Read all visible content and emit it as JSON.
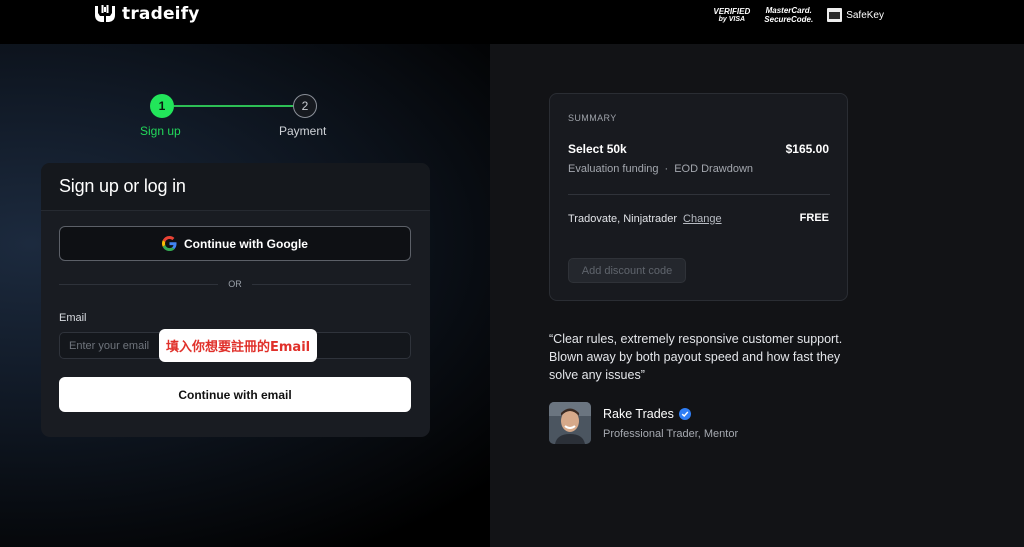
{
  "header": {
    "brand": "tradeify",
    "badges": {
      "visa_line1": "VERIFIED",
      "visa_line2": "by VISA",
      "mc_line1": "MasterCard.",
      "mc_line2": "SecureCode.",
      "safekey": "SafeKey"
    }
  },
  "steps": [
    {
      "number": "1",
      "label": "Sign up",
      "state": "active",
      "color": "#22e55a"
    },
    {
      "number": "2",
      "label": "Payment",
      "state": "pending"
    }
  ],
  "auth": {
    "title": "Sign up or log in",
    "google_button": "Continue with Google",
    "divider": "OR",
    "email_label": "Email",
    "email_placeholder": "Enter your email",
    "email_value": "",
    "annotation": "填入你想要註冊的Email",
    "email_button": "Continue with email"
  },
  "summary": {
    "caption": "SUMMARY",
    "plan": "Select 50k",
    "price": "$165.00",
    "funding": "Evaluation funding",
    "separator": "·",
    "drawdown": "EOD Drawdown",
    "platform": "Tradovate, Ninjatrader",
    "change_link": "Change",
    "platform_price": "FREE",
    "discount_button": "Add discount code"
  },
  "testimonial": {
    "quote": "“Clear rules, extremely responsive customer support. Blown away by both payout speed and how fast they solve any issues”",
    "name": "Rake Trades",
    "role": "Professional Trader, Mentor",
    "verified_color": "#2f7ef5"
  },
  "icons": {
    "logo": "hands-logo-icon",
    "google": "google-icon",
    "verified": "verified-check-icon",
    "amex": "amex-card-icon"
  }
}
